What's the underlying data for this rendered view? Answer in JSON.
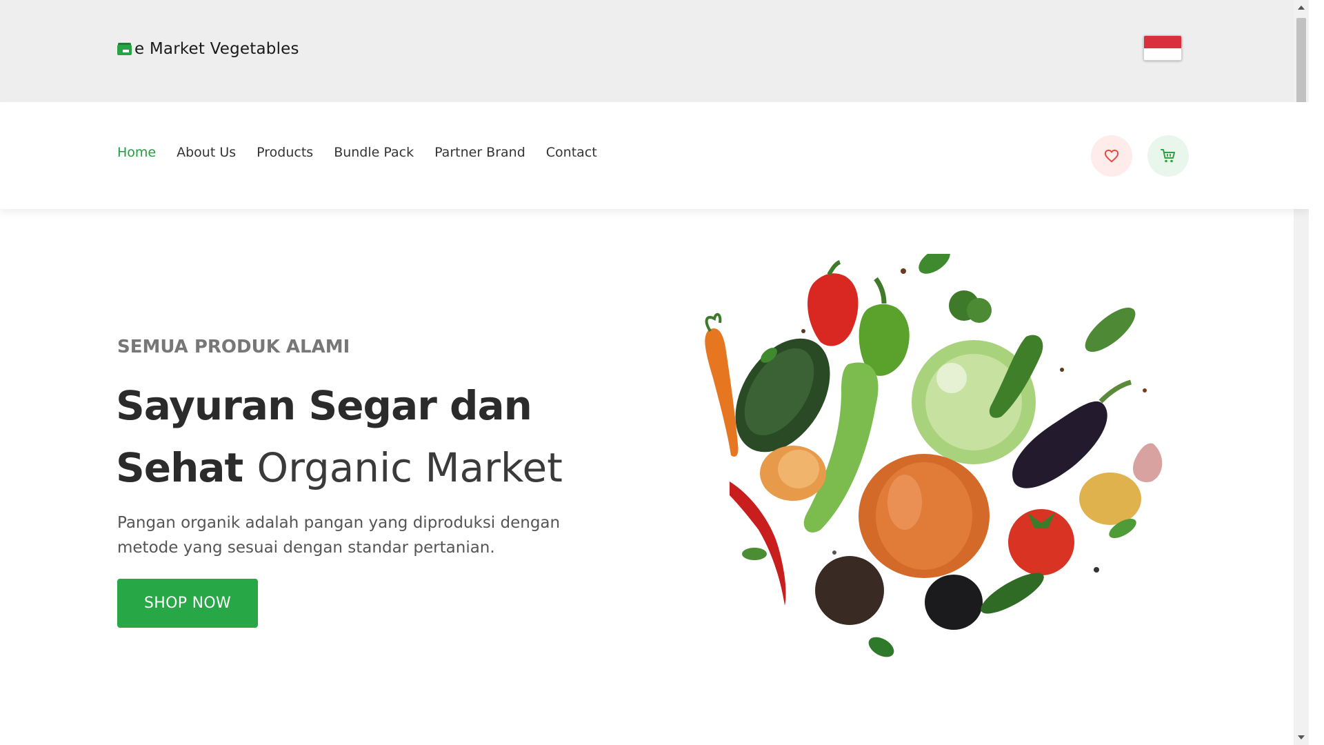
{
  "brand": {
    "name": "e Market Vegetables",
    "icon": "store-icon"
  },
  "topbar": {
    "flag": "indonesia-flag-icon",
    "flag_colors": [
      "#dc2f3e",
      "#ffffff"
    ]
  },
  "nav": {
    "items": [
      {
        "label": "Home",
        "active": true
      },
      {
        "label": "About Us",
        "active": false
      },
      {
        "label": "Products",
        "active": false
      },
      {
        "label": "Bundle Pack",
        "active": false
      },
      {
        "label": "Partner Brand",
        "active": false
      },
      {
        "label": "Contact",
        "active": false
      }
    ],
    "wishlist_icon": "heart-icon",
    "cart_icon": "cart-icon"
  },
  "hero": {
    "eyebrow": "SEMUA PRODUK ALAMI",
    "headline_line1": "Sayuran Segar dan",
    "headline_line2_bold": "Sehat",
    "headline_line2_thin": "Organic Market",
    "description": "Pangan organik adalah pangan yang diproduksi dengan metode yang sesuai dengan standar pertanian.",
    "cta": "SHOP NOW"
  },
  "colors": {
    "accent": "#27a745",
    "topbar_bg": "#eeeeef",
    "heart": "#e8493f"
  }
}
